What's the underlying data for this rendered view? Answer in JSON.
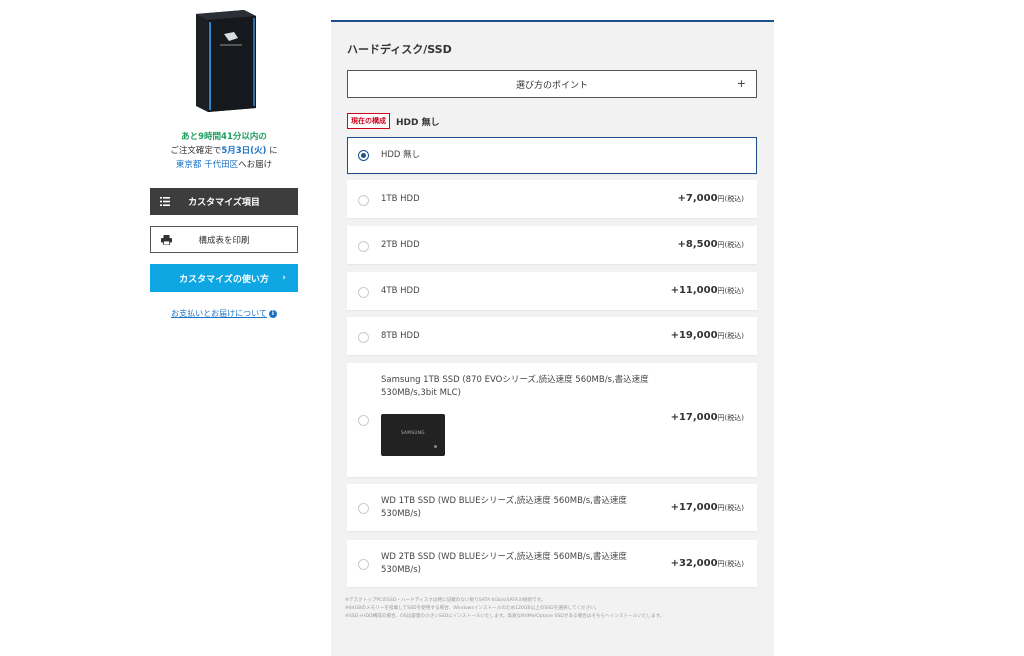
{
  "sidebar": {
    "delivery_line1": "あと9時間41分以内の",
    "delivery_line2_prefix": "ご注文確定で",
    "delivery_date": "5月3日(火)",
    "delivery_line2_suffix": " に",
    "delivery_pref": "東京都",
    "delivery_city": "千代田区",
    "delivery_line3_suffix": "へお届け",
    "customize_items_label": "カスタマイズ項目",
    "print_label": "構成表を印刷",
    "howto_label": "カスタマイズの使い方",
    "payment_link": "お支払いとお届けについて"
  },
  "section": {
    "title": "ハードディスク/SSD",
    "points_label": "選び方のポイント",
    "current_badge": "現在の構成",
    "current_value": "HDD 無し"
  },
  "options": [
    {
      "label": "HDD 無し",
      "price": "",
      "unit": ""
    },
    {
      "label": "1TB HDD",
      "price": "+7,000",
      "unit": "円(税込)"
    },
    {
      "label": "2TB HDD",
      "price": "+8,500",
      "unit": "円(税込)"
    },
    {
      "label": "4TB HDD",
      "price": "+11,000",
      "unit": "円(税込)"
    },
    {
      "label": "8TB HDD",
      "price": "+19,000",
      "unit": "円(税込)"
    },
    {
      "label": "Samsung 1TB SSD (870 EVOシリーズ,読込速度 560MB/s,書込速度 530MB/s,3bit MLC)",
      "price": "+17,000",
      "unit": "円(税込)",
      "image_text": "SAMSUNG"
    },
    {
      "label": "WD 1TB SSD (WD BLUEシリーズ,読込速度 560MB/s,書込速度 530MB/s)",
      "price": "+17,000",
      "unit": "円(税込)"
    },
    {
      "label": "WD 2TB SSD (WD BLUEシリーズ,読込速度 560MB/s,書込速度 530MB/s)",
      "price": "+32,000",
      "unit": "円(税込)"
    }
  ],
  "selected_option": "HDD 無し",
  "notes": [
    "※デスクトップPCのSSD・ハードディスクは特に記載のない限りSATA 6Gb/s(SATA3)接続です。",
    "※64GBのメモリーを搭載してSSDを使用する場合、Windowsインストールのため120GB以上のSSDを選択してください。",
    "※SSD+HDD構成の場合、OSは容量の小さいSSDにインストールいたします。高速なNVMe/Optane SSDがある場合はそちらへインストールいたします。"
  ],
  "colors": {
    "accent": "#1f4e8c",
    "green": "#1a9e5c",
    "cyan_button": "#0ea6e3",
    "badge_red": "#d0021b"
  }
}
